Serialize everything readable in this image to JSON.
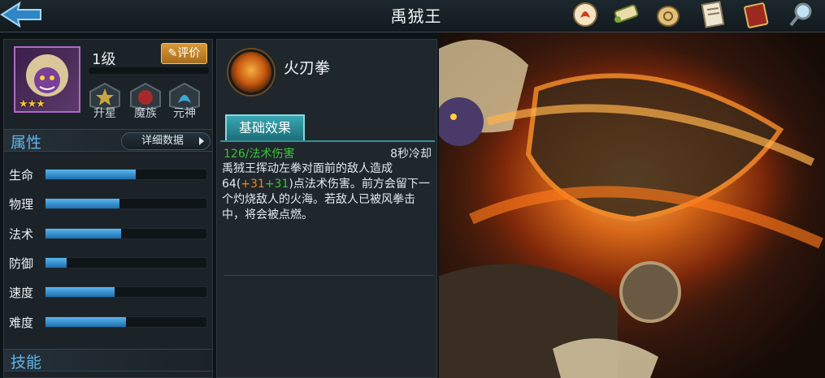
{
  "header": {
    "title": "禹狨王"
  },
  "hero": {
    "level": "1级",
    "stars": "★★★",
    "rate_label": "评价",
    "upgrades": [
      {
        "label": "升星"
      },
      {
        "label": "魔族"
      },
      {
        "label": "元神"
      }
    ]
  },
  "attributes": {
    "title": "属性",
    "detail_label": "详细数据",
    "stats": [
      {
        "label": "生命",
        "value": 0.56
      },
      {
        "label": "物理",
        "value": 0.46
      },
      {
        "label": "法术",
        "value": 0.47
      },
      {
        "label": "防御",
        "value": 0.13
      },
      {
        "label": "速度",
        "value": 0.43
      },
      {
        "label": "难度",
        "value": 0.5
      }
    ]
  },
  "skills_section": {
    "title": "技能"
  },
  "skill": {
    "name": "火刃拳",
    "tab_label": "基础效果",
    "damage": "126/法术伤害",
    "cooldown": "8秒冷却",
    "desc_part1": "禹狨王挥动左拳对面前的敌人造成64(",
    "desc_bonus1": "+31",
    "desc_bonus2": "+31",
    "desc_part2": ")点法术伤害。前方会留下一个灼烧敌人的火海。若敌人已被风拳击中，将会被点燃。"
  },
  "icons": {
    "back": "back-arrow-icon",
    "top_bar": [
      "fire-scroll-icon",
      "scroll-icon",
      "coin-bag-icon",
      "document-icon",
      "book-icon",
      "magnifier-icon"
    ]
  },
  "colors": {
    "accent_blue": "#5fb6e8",
    "bar_fill": "#3a93d3",
    "damage_green": "#3dc23a",
    "bonus_orange": "#f2851d",
    "rate_gold": "#d99a39",
    "tab_teal": "#3aa8b4"
  }
}
